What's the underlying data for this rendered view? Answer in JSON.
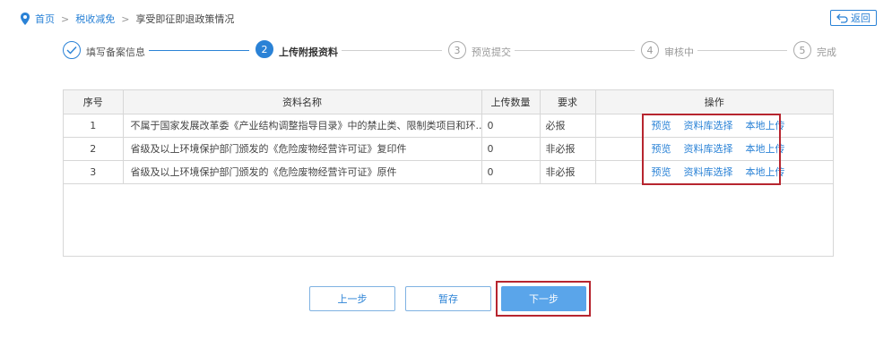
{
  "breadcrumb": {
    "home": "首页",
    "section": "税收减免",
    "current": "享受即征即退政策情况",
    "separator": ">"
  },
  "back_button": {
    "label": "返回"
  },
  "steps": [
    {
      "number": "✓",
      "label": "填写备案信息",
      "state": "done"
    },
    {
      "number": "2",
      "label": "上传附报资料",
      "state": "active"
    },
    {
      "number": "3",
      "label": "预览提交",
      "state": "pending"
    },
    {
      "number": "4",
      "label": "审核中",
      "state": "pending"
    },
    {
      "number": "5",
      "label": "完成",
      "state": "pending"
    }
  ],
  "table": {
    "headers": [
      "序号",
      "资料名称",
      "上传数量",
      "要求",
      "操作"
    ],
    "rows": [
      {
        "no": "1",
        "name": "不属于国家发展改革委《产业结构调整指导目录》中的禁止类、限制类项目和环...",
        "count": "0",
        "requirement": "必报"
      },
      {
        "no": "2",
        "name": "省级及以上环境保护部门颁发的《危险废物经营许可证》复印件",
        "count": "0",
        "requirement": "非必报"
      },
      {
        "no": "3",
        "name": "省级及以上环境保护部门颁发的《危险废物经营许可证》原件",
        "count": "0",
        "requirement": "非必报"
      }
    ],
    "actions": [
      "预览",
      "资料库选择",
      "本地上传"
    ]
  },
  "buttons": {
    "prev": "上一步",
    "save": "暂存",
    "next": "下一步"
  },
  "colors": {
    "accent": "#2a82d6",
    "primary_button": "#5aa5ea",
    "highlight": "#b7252f"
  }
}
